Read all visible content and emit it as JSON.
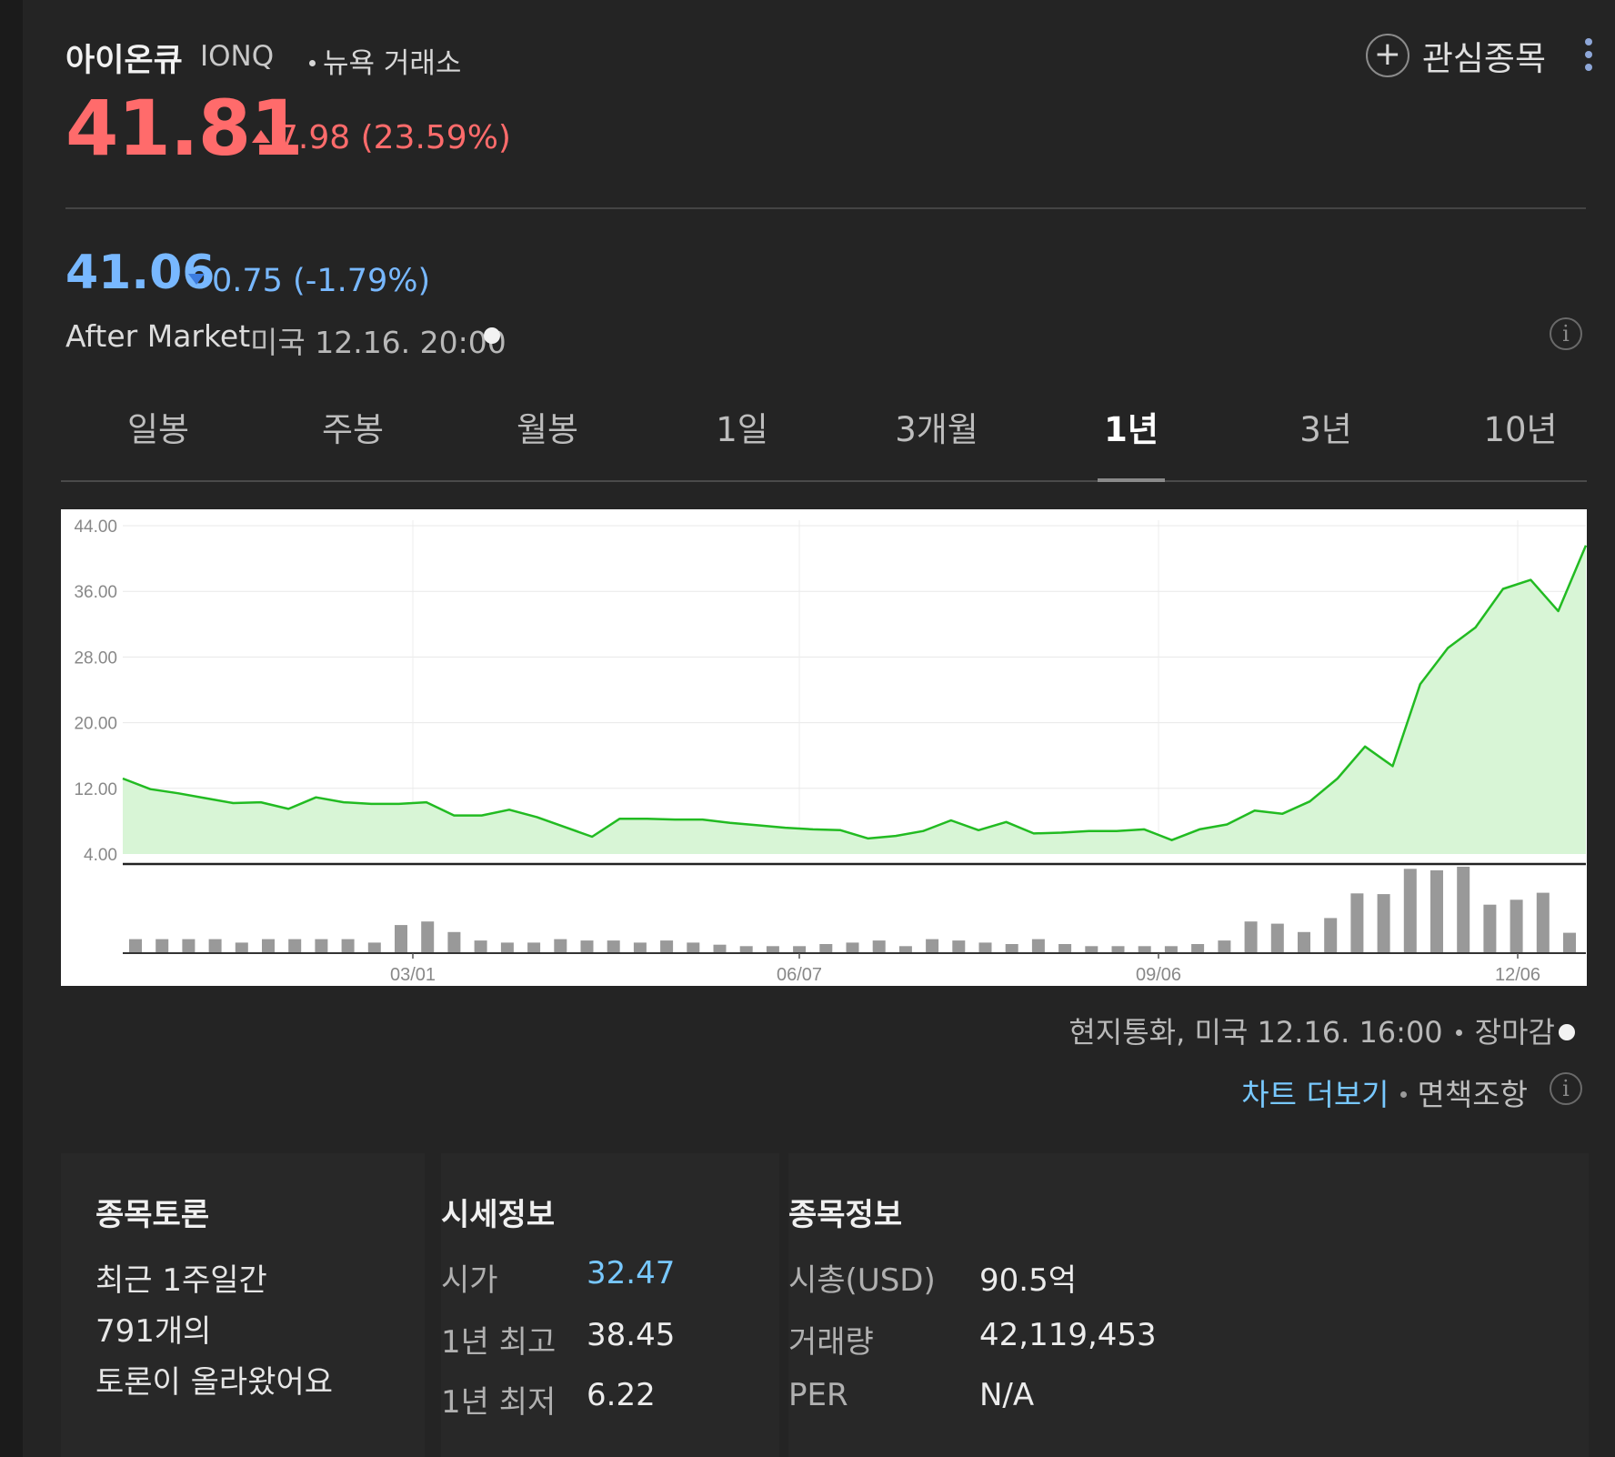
{
  "header": {
    "name": "아이온큐",
    "ticker": "IONQ",
    "exchange": "뉴욕 거래소",
    "watch_label": "관심종목"
  },
  "quote": {
    "price": "41.81",
    "change": "7.98 (23.59%)",
    "up_color": "#ff6b6b"
  },
  "after_market": {
    "price": "41.06",
    "change": "0.75 (-1.79%)",
    "label": "After Market",
    "time": "미국 12.16. 20:00",
    "down_color": "#78b8ff"
  },
  "tabs": [
    {
      "label": "일봉",
      "active": false
    },
    {
      "label": "주봉",
      "active": false
    },
    {
      "label": "월봉",
      "active": false
    },
    {
      "label": "1일",
      "active": false
    },
    {
      "label": "3개월",
      "active": false
    },
    {
      "label": "1년",
      "active": true
    },
    {
      "label": "3년",
      "active": false
    },
    {
      "label": "10년",
      "active": false
    }
  ],
  "chart_data": {
    "type": "area",
    "yticks": [
      "44.00",
      "36.00",
      "28.00",
      "20.00",
      "12.00",
      "4.00"
    ],
    "ylim": [
      4,
      44
    ],
    "xticks": [
      "03/01",
      "06/07",
      "09/06",
      "12/06"
    ],
    "grid": true,
    "line_color": "#22bb22",
    "fill_color": "#d8f5d6",
    "volume_color": "#999999",
    "prices": [
      13.2,
      11.9,
      11.4,
      10.8,
      10.2,
      10.3,
      9.5,
      10.9,
      10.3,
      10.1,
      10.1,
      10.3,
      8.7,
      8.7,
      9.4,
      8.5,
      7.3,
      6.1,
      8.3,
      8.3,
      8.2,
      8.2,
      7.8,
      7.5,
      7.2,
      7.0,
      6.9,
      5.9,
      6.2,
      6.8,
      8.1,
      6.9,
      7.9,
      6.5,
      6.6,
      6.8,
      6.8,
      7.0,
      5.7,
      7.0,
      7.6,
      9.3,
      8.9,
      10.4,
      13.2,
      17.1,
      14.7,
      24.7,
      29.1,
      31.6,
      36.3,
      37.4,
      33.6,
      41.6
    ],
    "volumes": [
      2,
      2,
      2,
      2,
      1.5,
      2,
      2,
      2,
      2,
      1.5,
      4,
      4.5,
      3,
      1.8,
      1.5,
      1.5,
      2,
      1.8,
      1.8,
      1.5,
      1.8,
      1.5,
      1.2,
      1,
      1,
      1,
      1.3,
      1.5,
      1.8,
      1,
      2,
      1.8,
      1.5,
      1.3,
      2,
      1.3,
      1,
      1,
      1,
      1,
      1.3,
      1.8,
      4.5,
      4.2,
      3,
      5,
      8.5,
      8.4,
      12,
      11.8,
      12.3,
      6.9,
      7.6,
      8.6,
      2.9
    ]
  },
  "chart_footer": {
    "currency_time": "현지통화, 미국 12.16. 16:00",
    "status": "장마감",
    "chart_more": "차트 더보기",
    "disclaimer": "면책조항"
  },
  "forum": {
    "title": "종목토론",
    "line1": "최근 1주일간",
    "line2": "791개의",
    "line3": "토론이 올라왔어요"
  },
  "market_info": {
    "title": "시세정보",
    "rows": [
      {
        "label": "시가",
        "value": "32.47"
      },
      {
        "label": "1년 최고",
        "value": "38.45"
      },
      {
        "label": "1년 최저",
        "value": "6.22"
      }
    ]
  },
  "stock_info": {
    "title": "종목정보",
    "rows": [
      {
        "label": "시총(USD)",
        "value": "90.5억"
      },
      {
        "label": "거래량",
        "value": "42,119,453"
      },
      {
        "label": "PER",
        "value": "N/A"
      }
    ]
  }
}
